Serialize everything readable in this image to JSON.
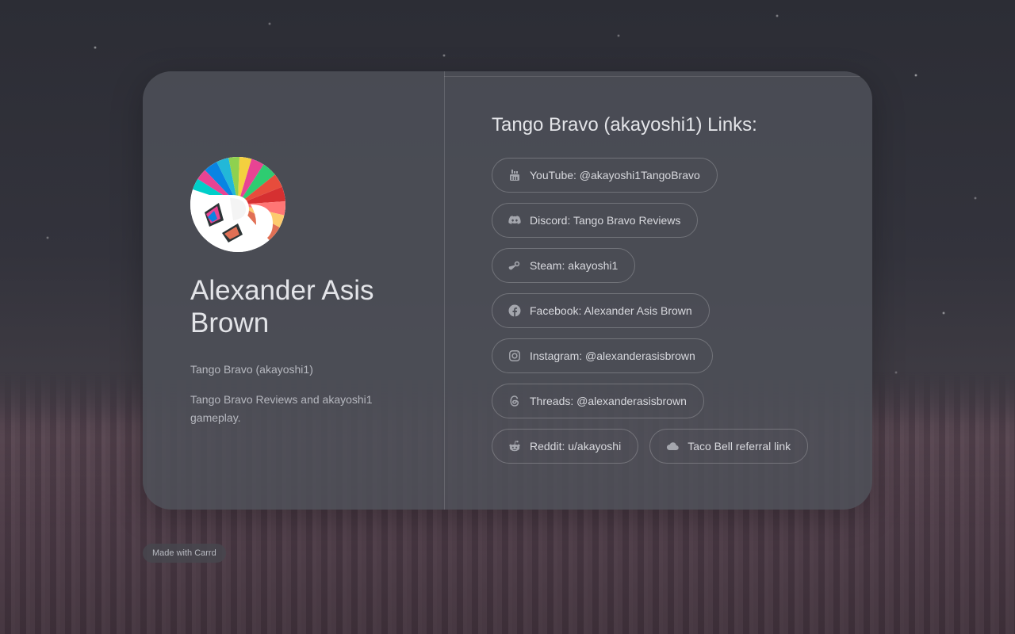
{
  "profile": {
    "name": "Alexander Asis Brown",
    "subtitle": "Tango Bravo (akayoshi1)",
    "description": "Tango Bravo Reviews and akayoshi1 gameplay."
  },
  "links_section": {
    "title": "Tango Bravo (akayoshi1) Links:",
    "items": [
      {
        "label": "YouTube: @akayoshi1TangoBravo",
        "icon": "youtube-icon"
      },
      {
        "label": "Discord: Tango Bravo Reviews",
        "icon": "discord-icon"
      },
      {
        "label": "Steam: akayoshi1",
        "icon": "steam-icon"
      },
      {
        "label": "Facebook: Alexander Asis Brown",
        "icon": "facebook-icon"
      },
      {
        "label": "Instagram: @alexanderasisbrown",
        "icon": "instagram-icon"
      },
      {
        "label": "Threads: @alexanderasisbrown",
        "icon": "threads-icon"
      },
      {
        "label": "Reddit: u/akayoshi",
        "icon": "reddit-icon"
      },
      {
        "label": "Taco Bell referral link",
        "icon": "cloud-icon"
      }
    ]
  },
  "footer": {
    "made_with": "Made with Carrd"
  },
  "colors": {
    "card": "#4e5058",
    "text": "#e3e4e8",
    "muted": "#b6b8bf"
  }
}
